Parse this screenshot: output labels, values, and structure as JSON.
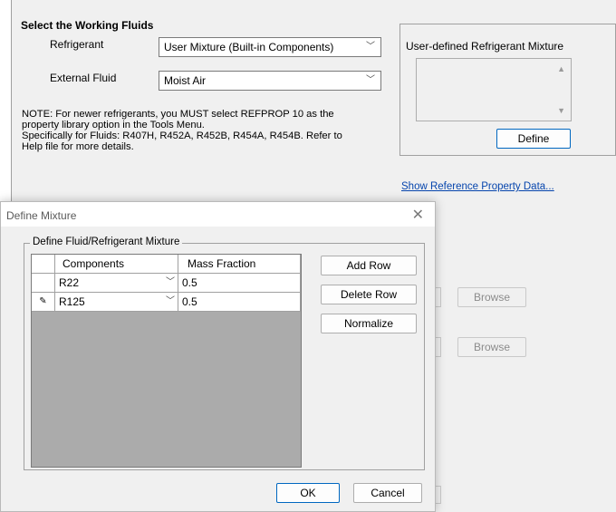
{
  "working_fluids": {
    "title": "Select the Working Fluids",
    "refrigerant_label": "Refrigerant",
    "refrigerant_value": "User Mixture (Built-in Components)",
    "external_fluid_label": "External Fluid",
    "external_fluid_value": "Moist Air",
    "note_lines": [
      "NOTE: For newer refrigerants, you MUST select REFPROP 10 as the",
      "property library option in the Tools Menu.",
      "Specifically for Fluids: R407H, R452A, R452B, R454A, R454B. Refer to",
      "Help file for more details."
    ]
  },
  "mixture_panel": {
    "title": "User-defined Refrigerant Mixture",
    "define_label": "Define"
  },
  "reference_link": "Show Reference Property Data...",
  "background_buttons": {
    "browse_1": "Browse",
    "browse_2": "Browse"
  },
  "dialog": {
    "title": "Define Mixture",
    "close_glyph": "✕",
    "group_title": "Define Fluid/Refrigerant Mixture",
    "columns": [
      "Components",
      "Mass Fraction"
    ],
    "rows": [
      {
        "marker": "",
        "component": "R22",
        "fraction": "0.5"
      },
      {
        "marker": "✎",
        "component": "R125",
        "fraction": "0.5"
      }
    ],
    "add_row": "Add Row",
    "delete_row": "Delete Row",
    "normalize": "Normalize",
    "ok": "OK",
    "cancel": "Cancel"
  },
  "icons": {
    "dropdown": "chevron-down-icon",
    "scroll_up": "triangle-up-icon",
    "scroll_down": "triangle-down-icon",
    "edit_row": "pencil-icon",
    "close": "close-icon"
  }
}
